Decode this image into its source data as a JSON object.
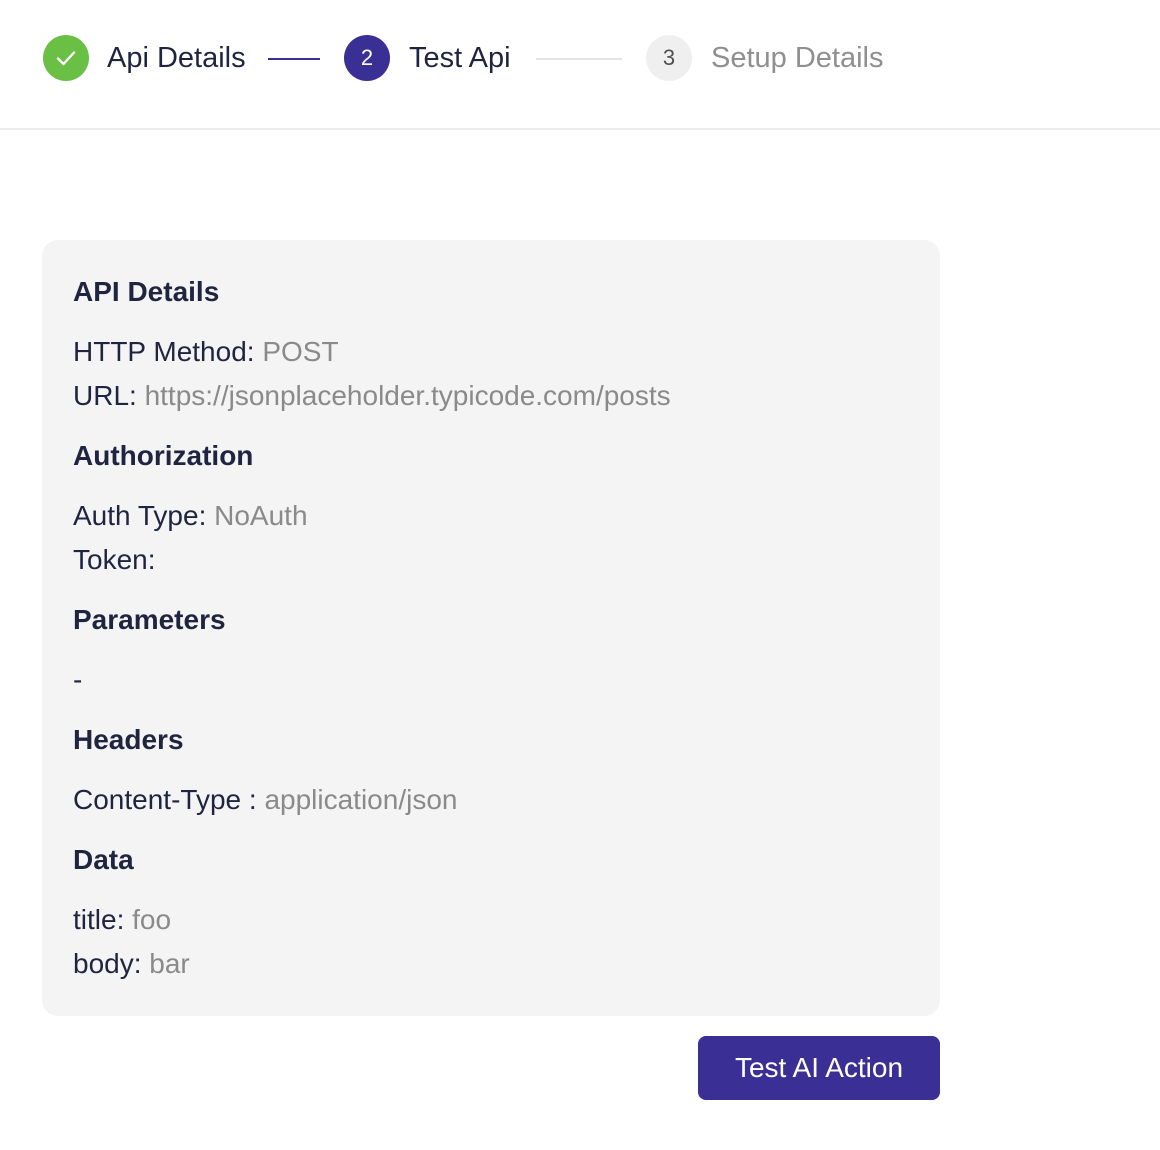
{
  "stepper": {
    "steps": [
      {
        "number": "",
        "label": "Api Details",
        "state": "complete",
        "icon": "check-icon"
      },
      {
        "number": "2",
        "label": "Test Api",
        "state": "active"
      },
      {
        "number": "3",
        "label": "Setup Details",
        "state": "upcoming"
      }
    ]
  },
  "api_card": {
    "api_details": {
      "heading": "API Details",
      "method_label": "HTTP Method:",
      "method_value": "POST",
      "url_label": "URL:",
      "url_value": "https://jsonplaceholder.typicode.com/posts"
    },
    "authorization": {
      "heading": "Authorization",
      "auth_type_label": "Auth Type:",
      "auth_type_value": "NoAuth",
      "token_label": "Token:",
      "token_value": ""
    },
    "parameters": {
      "heading": "Parameters",
      "value": "-"
    },
    "headers": {
      "heading": "Headers",
      "items": [
        {
          "key": "Content-Type :",
          "value": "application/json"
        }
      ]
    },
    "data": {
      "heading": "Data",
      "items": [
        {
          "key": "title:",
          "value": "foo"
        },
        {
          "key": "body:",
          "value": "bar"
        }
      ]
    }
  },
  "actions": {
    "test_button_label": "Test AI Action"
  },
  "colors": {
    "primary": "#3a2f94",
    "success": "#6abf45",
    "card_background": "#f4f4f4",
    "muted_text": "#8a8a8a"
  }
}
